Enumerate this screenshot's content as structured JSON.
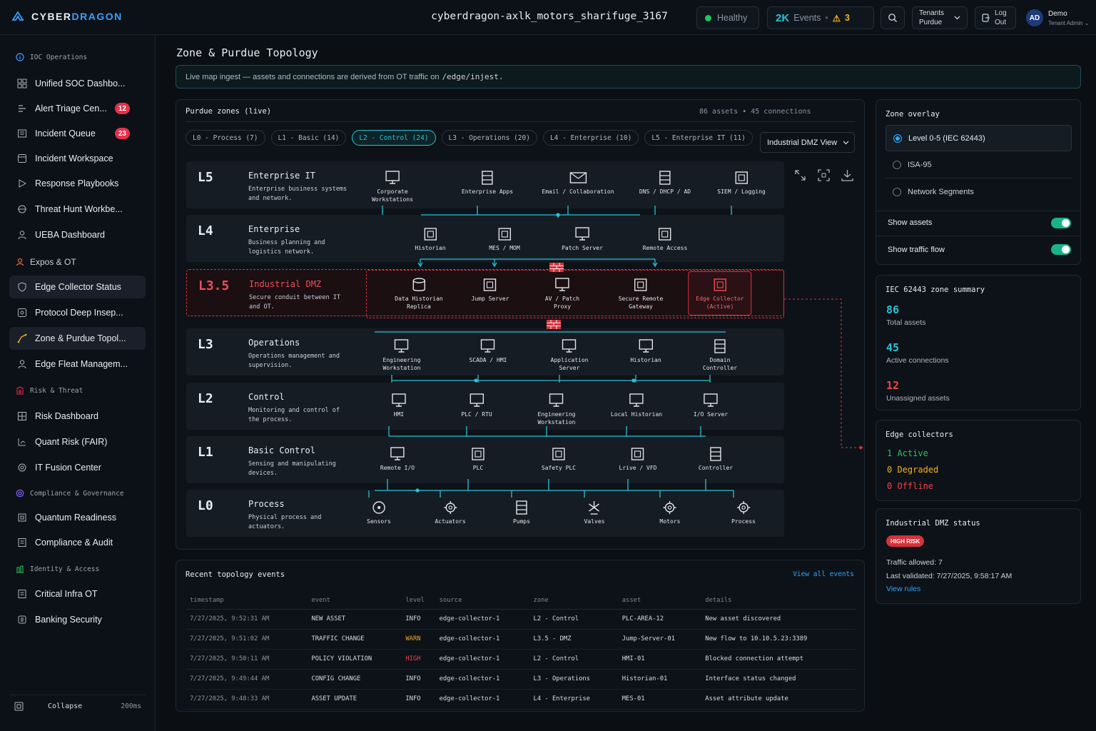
{
  "header": {
    "brand_a": "CYBER",
    "brand_b": "DRAGON",
    "instance": "cyberdragon-axlk_motors_sharifuge_3167",
    "health": "Healthy",
    "events_count": "2K",
    "events_label": "Events",
    "alerts": "3",
    "tenants_label": "Tenants",
    "tenants_value": "Purdue",
    "logout_a": "Log",
    "logout_b": "Out",
    "avatar": "AD",
    "user_name": "Demo",
    "user_role": "Tenant Admin"
  },
  "sidebar": {
    "sections": [
      {
        "label": "IOC Operations"
      },
      {
        "label": "Expos & OT"
      },
      {
        "label": "Risk & Threat"
      },
      {
        "label": "Compliance & Governance"
      },
      {
        "label": "Identity & Access"
      }
    ],
    "items": [
      {
        "label": "Unified SOC Dashbo..."
      },
      {
        "label": "Alert Triage Cen...",
        "badge": "12"
      },
      {
        "label": "Incident Queue",
        "badge": "23"
      },
      {
        "label": "Incident Workspace"
      },
      {
        "label": "Response Playbooks"
      },
      {
        "label": "Threat Hunt Workbe..."
      },
      {
        "label": "UEBA Dashboard"
      },
      {
        "label": "Edge Collector Status"
      },
      {
        "label": "Protocol Deep Insep..."
      },
      {
        "label": "Zone & Purdue Topol..."
      },
      {
        "label": "Edge Fleat Managem..."
      },
      {
        "label": "Risk Dashboard"
      },
      {
        "label": "Quant Risk (FAIR)"
      },
      {
        "label": "IT Fusion Center"
      },
      {
        "label": "Quantum Readiness"
      },
      {
        "label": "Compliance & Audit"
      },
      {
        "label": "Critical Infra OT"
      },
      {
        "label": "Banking Security"
      }
    ],
    "collapse": "Collapse",
    "latency": "200ms"
  },
  "page": {
    "title": "Zone & Purdue Topology",
    "banner": "Live map ingest — assets and connections are derived from OT traffic on",
    "banner_path": "/edge/injest."
  },
  "topology": {
    "title": "Purdue zones (live)",
    "meta": "86 assets • 45 connections",
    "view_select": "Industrial DMZ View",
    "chips": [
      "L0 - Process (7)",
      "L1 - Basic (14)",
      "L2 - Control (24)",
      "L3 - Operations (20)",
      "L4 - Enterprise (10)",
      "L5 - Enterprise IT (11)"
    ],
    "levels": [
      {
        "id": "L5",
        "name": "Enterprise IT",
        "desc": "Enterprise business systems and network.",
        "nodes": [
          "Corporate\nWorkstations",
          "Enterprise Apps",
          "Email / Collaboration",
          "DNS / DHCP / AD",
          "SIEM / Logging"
        ]
      },
      {
        "id": "L4",
        "name": "Enterprise",
        "desc": "Business planning and logistics network.",
        "nodes": [
          "Historian",
          "MES / MOM",
          "Patch Server",
          "Remote Access"
        ]
      },
      {
        "id": "L3.5",
        "name": "Industrial DMZ",
        "desc": "Secure conduit between IT and OT.",
        "nodes": [
          "Data Historian\nReplica",
          "Jump Server",
          "AV / Patch\nProxy",
          "Secure Remote\nGateway",
          "Edge Collector\n(Active)"
        ]
      },
      {
        "id": "L3",
        "name": "Operations",
        "desc": "Operations management and supervision.",
        "nodes": [
          "Engineering\nWorkstation",
          "SCADA / HMI",
          "Application\nServer",
          "Historian",
          "Domain\nController"
        ]
      },
      {
        "id": "L2",
        "name": "Control",
        "desc": "Monitoring and control of the process.",
        "nodes": [
          "HMI",
          "PLC / RTU",
          "Engineering\nWorkstation",
          "Local Historian",
          "I/O Server"
        ]
      },
      {
        "id": "L1",
        "name": "Basic Control",
        "desc": "Sensing and manipulating devices.",
        "nodes": [
          "Remote I/O",
          "PLC",
          "Safety PLC",
          "Lrive / VFD",
          "Controller"
        ]
      },
      {
        "id": "L0",
        "name": "Process",
        "desc": "Physical process and actuators.",
        "nodes": [
          "Sensors",
          "Actuators",
          "Pumps",
          "Valves",
          "Motors",
          "Process"
        ]
      }
    ]
  },
  "events": {
    "title": "Recent topology events",
    "view_all": "View all events",
    "columns": [
      "timestamp",
      "event",
      "level",
      "source",
      "zone",
      "asset",
      "details"
    ],
    "rows": [
      [
        "7/27/2025, 9:52:31 AM",
        "NEW ASSET",
        "INFO",
        "edge-collector-1",
        "L2 - Control",
        "PLC-AREA-12",
        "New asset discovered"
      ],
      [
        "7/27/2025, 9:51:02 AM",
        "TRAFFIC CHANGE",
        "WARN",
        "edge-collector-1",
        "L3.5 - DMZ",
        "Jump-Server-01",
        "New flow to 10.10.5.23:3389"
      ],
      [
        "7/27/2025, 9:50:11 AM",
        "POLICY VIOLATION",
        "HIGH",
        "edge-collector-1",
        "L2 - Control",
        "HMI-01",
        "Blocked connection attempt"
      ],
      [
        "7/27/2025, 9:49:44 AM",
        "CONFIG CHANGE",
        "INFO",
        "edge-collector-1",
        "L3 - Operations",
        "Historian-01",
        "Interface status changed"
      ],
      [
        "7/27/2025, 9:48:33 AM",
        "ASSET UPDATE",
        "INFO",
        "edge-collector-1",
        "L4 - Enterprise",
        "MES-01",
        "Asset attribute update"
      ]
    ],
    "level_colors": {
      "INFO": "#d7dde4",
      "WARN": "#f5a623",
      "HIGH": "#ef4444"
    }
  },
  "overlay": {
    "title": "Zone overlay",
    "options": [
      "Level 0-5 (IEC 62443)",
      "ISA-95",
      "Network Segments"
    ],
    "show_assets": "Show assets",
    "show_flow": "Show traffic flow"
  },
  "summary": {
    "title": "IEC 62443 zone summary",
    "stats": [
      {
        "value": "86",
        "label": "Total assets"
      },
      {
        "value": "45",
        "label": "Active connections"
      },
      {
        "value": "12",
        "label": "Unassigned assets"
      }
    ]
  },
  "collectors": {
    "title": "Edge collectors",
    "active": "1 Active",
    "degraded": "0 Degraded",
    "offline": "0 Offline"
  },
  "dmz_status": {
    "title": "Industrial DMZ status",
    "risk": "HIGH RISK",
    "traffic": "Traffic allowed: 7",
    "validated": "Last validated: 7/27/2025, 9:58:17 AM",
    "rules": "View rules"
  },
  "colors": {
    "accent": "#27c3d6",
    "danger": "#d6323b",
    "success": "#22c55e",
    "warning": "#f5b21a"
  }
}
